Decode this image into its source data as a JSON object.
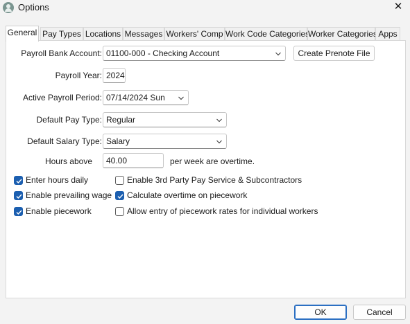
{
  "window": {
    "title": "Options",
    "close_glyph": "✕"
  },
  "tabs": [
    {
      "label": "General",
      "active": true
    },
    {
      "label": "Pay Types"
    },
    {
      "label": "Locations"
    },
    {
      "label": "Messages"
    },
    {
      "label": "Workers' Comp"
    },
    {
      "label": "Work Code Categories"
    },
    {
      "label": "Worker Categories"
    },
    {
      "label": "Apps"
    }
  ],
  "general": {
    "bank_account": {
      "label": "Payroll Bank Account:",
      "value": "01100-000 - Checking Account"
    },
    "prenote_button": "Create Prenote File",
    "payroll_year": {
      "label": "Payroll Year:",
      "value": "2024"
    },
    "active_period": {
      "label": "Active Payroll Period:",
      "value": "07/14/2024 Sun"
    },
    "default_pay_type": {
      "label": "Default Pay Type:",
      "value": "Regular"
    },
    "default_salary_type": {
      "label": "Default Salary Type:",
      "value": "Salary"
    },
    "hours_above": {
      "label": "Hours above",
      "value": "40.00",
      "suffix": "per week are overtime."
    }
  },
  "checkboxes": [
    {
      "label": "Enter hours daily",
      "checked": true
    },
    {
      "label": "Enable 3rd Party Pay Service & Subcontractors",
      "checked": false
    },
    {
      "label": "Enable prevailing wage",
      "checked": true
    },
    {
      "label": "Calculate overtime on piecework",
      "checked": true
    },
    {
      "label": "Enable piecework",
      "checked": true
    },
    {
      "label": "Allow entry of piecework rates for individual workers",
      "checked": false
    }
  ],
  "footer": {
    "ok_label": "OK",
    "cancel_label": "Cancel"
  },
  "colors": {
    "accent": "#1c5fb0",
    "primary_border": "#2b6fc2"
  }
}
